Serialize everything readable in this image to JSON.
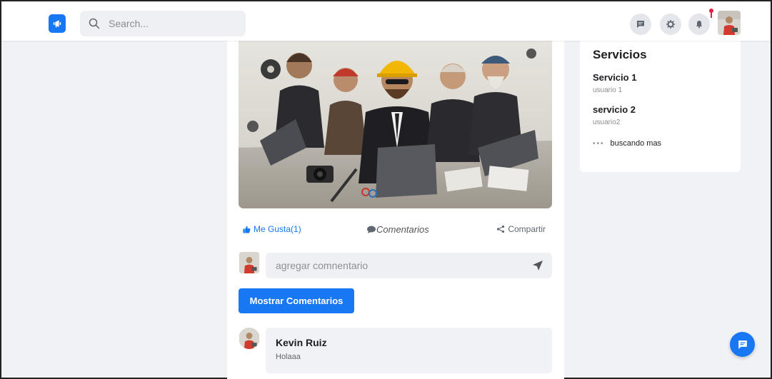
{
  "header": {
    "search_placeholder": "Search..."
  },
  "post": {
    "actions": {
      "like_label": "Me Gusta(1)",
      "comments_label": "Comentarios",
      "share_label": "Compartir"
    },
    "comment_input_placeholder": "agregar comnentario",
    "show_comments_label": "Mostrar Comentarios",
    "comments": [
      {
        "author": "Kevin Ruiz",
        "text": "Holaaa"
      }
    ]
  },
  "services": {
    "title": "Servicios",
    "items": [
      {
        "name": "Servicio 1",
        "user": "usuario 1"
      },
      {
        "name": "servicio 2",
        "user": "usuario2"
      }
    ],
    "more_label": "buscando mas"
  },
  "colors": {
    "brand": "#1877f2",
    "background": "#f0f2f5",
    "notification": "#e41e3f"
  },
  "icons": {
    "logo": "megaphone-icon",
    "search": "search-icon",
    "messages": "message-icon",
    "settings": "gear-icon",
    "notifications": "bell-icon",
    "like": "thumbs-up-icon",
    "comments": "comment-icon",
    "share": "share-icon",
    "send": "send-icon",
    "chat": "chat-icon"
  }
}
